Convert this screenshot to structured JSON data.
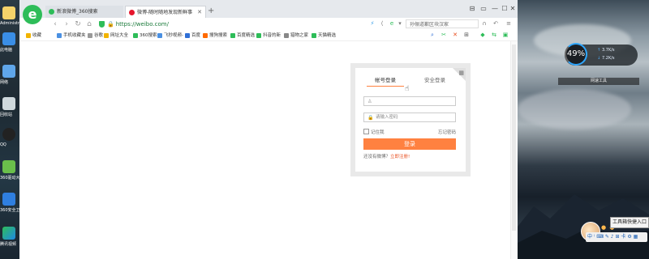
{
  "desktop_left": {
    "icons": [
      {
        "label": "Administrato"
      },
      {
        "label": "此电脑"
      },
      {
        "label": "网络"
      },
      {
        "label": "回收站"
      },
      {
        "label": "QQ"
      },
      {
        "label": "360驱动大师"
      },
      {
        "label": "360安全卫士"
      },
      {
        "label": "腾讯视频"
      }
    ]
  },
  "browser": {
    "logo": "e",
    "tabs": [
      {
        "label": "新浪微博_360搜索",
        "active": false
      },
      {
        "label": "微博-随时随地发现新鲜事",
        "active": true
      }
    ],
    "new_tab": "+",
    "window_controls": [
      "⊟",
      "▭",
      "—",
      "☐",
      "✕"
    ],
    "nav": {
      "back": "‹",
      "forward": "›",
      "refresh": "↻",
      "home": "⌂",
      "url": "https://weibo.com/",
      "search_text": "孙俪道歉区块汉家"
    },
    "bookmarks": [
      {
        "label": "收藏",
        "color": "#f2b400"
      },
      {
        "label": "手机收藏夹",
        "color": "#4a90e2"
      },
      {
        "label": "谷歌",
        "color": "#999999"
      },
      {
        "label": "网址大全",
        "color": "#f2b400"
      },
      {
        "label": "360搜索",
        "color": "#2ebd59"
      },
      {
        "label": "飞秒视频-",
        "color": "#4a90e2"
      },
      {
        "label": "百度",
        "color": "#2f6fd6"
      },
      {
        "label": "搜狗搜索",
        "color": "#ff6a00"
      },
      {
        "label": "百度精选",
        "color": "#2ebd59"
      },
      {
        "label": "抖音的新",
        "color": "#2ebd59"
      },
      {
        "label": "猎物之家",
        "color": "#888888"
      },
      {
        "label": "天猫精选",
        "color": "#2ebd59"
      }
    ]
  },
  "login": {
    "tab_account": "帐号登录",
    "tab_secure": "安全登录",
    "username_placeholder": "",
    "password_placeholder": "请输入密码",
    "remember": "记住我",
    "forgot": "忘记密码",
    "submit": "登录",
    "no_account": "还没有微博？",
    "register": "立即注册!"
  },
  "desktop_right": {
    "net_percent": "49%",
    "up_speed": "3.7K/s",
    "down_speed": "7.2K/s",
    "widget_label": "网速工具",
    "tooltip": "工具箱快捷入口",
    "dots": "● ●",
    "ime_text": "中 ⁾ ⌨ ✎ ♪ ⊞ 卡 ⚙ ▦"
  },
  "colors": {
    "accent_orange": "#ff8140",
    "brand_green": "#2ebd59"
  }
}
